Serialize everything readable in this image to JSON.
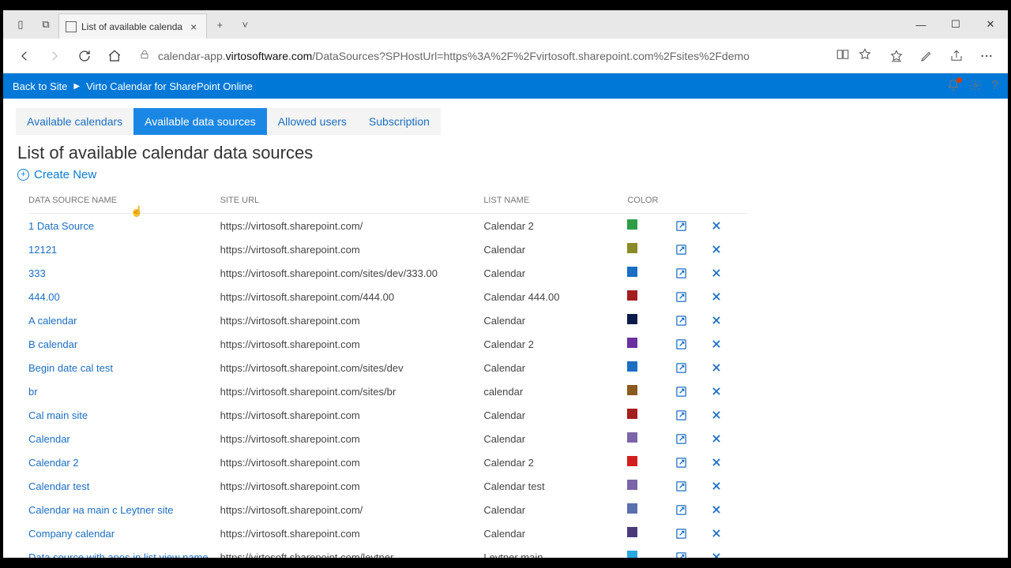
{
  "browser": {
    "tab_title": "List of available calenda",
    "url_pre": "calendar-app.",
    "url_domain": "virtosoftware.com",
    "url_path": "/DataSources?SPHostUrl=https%3A%2F%2Fvirtosoft.sharepoint.com%2Fsites%2Fdemo"
  },
  "spbar": {
    "back": "Back to Site",
    "app": "Virto Calendar for SharePoint Online"
  },
  "tabs": [
    {
      "label": "Available calendars",
      "active": false
    },
    {
      "label": "Available data sources",
      "active": true
    },
    {
      "label": "Allowed users",
      "active": false
    },
    {
      "label": "Subscription",
      "active": false
    }
  ],
  "page_title": "List of available calendar data sources",
  "create_label": "Create New",
  "columns": {
    "name": "Data Source Name",
    "site": "Site URL",
    "list": "List Name",
    "color": "Color"
  },
  "rows": [
    {
      "name": "1 Data Source",
      "site": "https://virtosoft.sharepoint.com/",
      "list": "Calendar 2",
      "color": "#2e9e46"
    },
    {
      "name": "12121",
      "site": "https://virtosoft.sharepoint.com",
      "list": "Calendar",
      "color": "#8a8a2b"
    },
    {
      "name": "333",
      "site": "https://virtosoft.sharepoint.com/sites/dev/333.00",
      "list": "Calendar",
      "color": "#1b6ec2"
    },
    {
      "name": "444.00",
      "site": "https://virtosoft.sharepoint.com/444.00",
      "list": "Calendar 444.00",
      "color": "#a41e1e"
    },
    {
      "name": "A calendar",
      "site": "https://virtosoft.sharepoint.com",
      "list": "Calendar",
      "color": "#0a1a4a"
    },
    {
      "name": "B calendar",
      "site": "https://virtosoft.sharepoint.com",
      "list": "Calendar 2",
      "color": "#6b2fa0"
    },
    {
      "name": "Begin date cal test",
      "site": "https://virtosoft.sharepoint.com/sites/dev",
      "list": "Calendar",
      "color": "#1b6ec2"
    },
    {
      "name": "br",
      "site": "https://virtosoft.sharepoint.com/sites/br",
      "list": "calendar",
      "color": "#8a5a1e"
    },
    {
      "name": "Cal main site",
      "site": "https://virtosoft.sharepoint.com",
      "list": "Calendar",
      "color": "#a41e1e"
    },
    {
      "name": "Calendar",
      "site": "https://virtosoft.sharepoint.com",
      "list": "Calendar",
      "color": "#7a65a8"
    },
    {
      "name": "Calendar 2",
      "site": "https://virtosoft.sharepoint.com",
      "list": "Calendar 2",
      "color": "#d21e1e"
    },
    {
      "name": "Calendar test",
      "site": "https://virtosoft.sharepoint.com",
      "list": "Calendar test",
      "color": "#7a65a8"
    },
    {
      "name": "Calendar на main с Leytner site",
      "site": "https://virtosoft.sharepoint.com/",
      "list": "Calendar",
      "color": "#5a6fb0"
    },
    {
      "name": "Company calendar",
      "site": "https://virtosoft.sharepoint.com",
      "list": "Calendar",
      "color": "#4a3a7a"
    },
    {
      "name": "Data source with apos in list view name",
      "site": "https://virtosoft.sharepoint.com/leytner",
      "list": "Leytner main",
      "color": "#2aa8e0"
    }
  ]
}
